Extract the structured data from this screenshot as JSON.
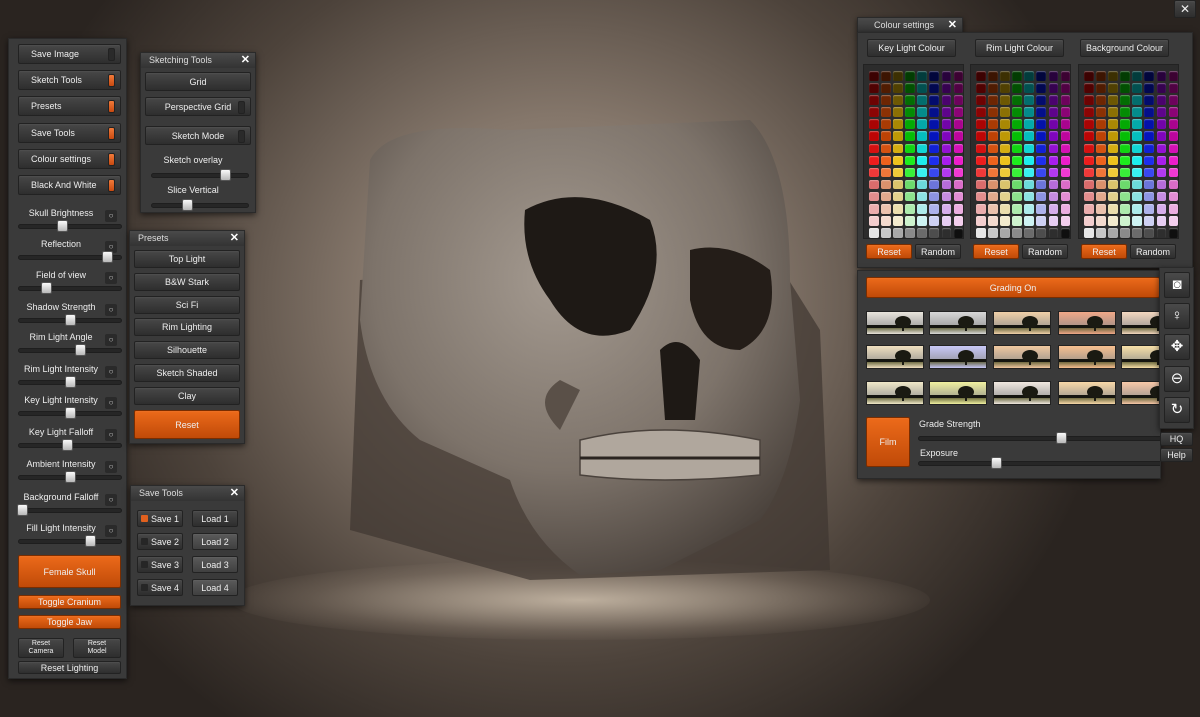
{
  "window": {
    "close_label": "✕"
  },
  "main_panel": {
    "toggles": [
      {
        "label": "Save Image",
        "on": false
      },
      {
        "label": "Sketch Tools",
        "on": true
      },
      {
        "label": "Presets",
        "on": true
      },
      {
        "label": "Save Tools",
        "on": true
      },
      {
        "label": "Colour settings",
        "on": true
      },
      {
        "label": "Black And White",
        "on": true
      }
    ],
    "sliders": [
      {
        "label": "Skull Brightness",
        "value": 0.42
      },
      {
        "label": "Reflection",
        "value": 0.86
      },
      {
        "label": "Field of view",
        "value": 0.26
      },
      {
        "label": "Shadow Strength",
        "value": 0.5
      },
      {
        "label": "Rim Light Angle",
        "value": 0.6
      },
      {
        "label": "Rim Light Intensity",
        "value": 0.5
      },
      {
        "label": "Key Light Intensity",
        "value": 0.5
      },
      {
        "label": "Key Light Falloff",
        "value": 0.47
      },
      {
        "label": "Ambient Intensity",
        "value": 0.5
      },
      {
        "label": "Background Falloff",
        "value": 0.03
      },
      {
        "label": "Fill Light Intensity",
        "value": 0.7
      }
    ],
    "female_skull": "Female Skull",
    "toggle_cranium": "Toggle Cranium",
    "toggle_jaw": "Toggle Jaw",
    "reset_camera": "Reset\nCamera",
    "reset_model": "Reset\nModel",
    "reset_lighting": "Reset Lighting"
  },
  "sketching_tools": {
    "title": "Sketching Tools",
    "grid": "Grid",
    "perspective_grid": "Perspective Grid",
    "sketch_mode": "Sketch Mode",
    "sketch_overlay": {
      "label": "Sketch overlay",
      "value": 0.76
    },
    "slice_vertical": {
      "label": "Slice Vertical",
      "value": 0.36
    }
  },
  "presets": {
    "title": "Presets",
    "items": [
      "Top Light",
      "B&W Stark",
      "Sci Fi",
      "Rim Lighting",
      "Silhouette",
      "Sketch Shaded",
      "Clay"
    ],
    "reset": "Reset"
  },
  "save_tools": {
    "title": "Save Tools",
    "rows": [
      {
        "save": "Save 1",
        "load": "Load 1",
        "saved": true
      },
      {
        "save": "Save 2",
        "load": "Load 2",
        "saved": false
      },
      {
        "save": "Save 3",
        "load": "Load 3",
        "saved": false
      },
      {
        "save": "Save 4",
        "load": "Load 4",
        "saved": false
      }
    ]
  },
  "colour_settings": {
    "title": "Colour settings",
    "groups": [
      {
        "label": "Key Light Colour",
        "reset": "Reset",
        "random": "Random"
      },
      {
        "label": "Rim Light Colour",
        "reset": "Reset",
        "random": "Random"
      },
      {
        "label": "Background Colour",
        "reset": "Reset",
        "random": "Random"
      }
    ],
    "palette_hues": [
      0,
      20,
      48,
      120,
      180,
      235,
      280,
      310
    ]
  },
  "grading": {
    "grading_on": "Grading On",
    "film": "Film",
    "grade_strength": {
      "label": "Grade Strength",
      "value": 0.55
    },
    "exposure": {
      "label": "Exposure",
      "value": 0.3
    },
    "thumb_tints": [
      "#e8e4dc",
      "#d8d8d8",
      "#f0d0a8",
      "#f0a888",
      "#f4d8c0",
      "#f0e0c0",
      "#c8c8f8",
      "#f0c8a0",
      "#f8c090",
      "#f8e0a8",
      "#f0e8c8",
      "#f0f0a0",
      "#f0e8e0",
      "#f8d8a8",
      "#f8c8a8"
    ]
  },
  "toolbar": {
    "icons": [
      "camera-icon",
      "lightbulb-icon",
      "move-icon",
      "zoom-out-icon",
      "rotate-icon"
    ],
    "hq": "HQ",
    "help": "Help"
  }
}
